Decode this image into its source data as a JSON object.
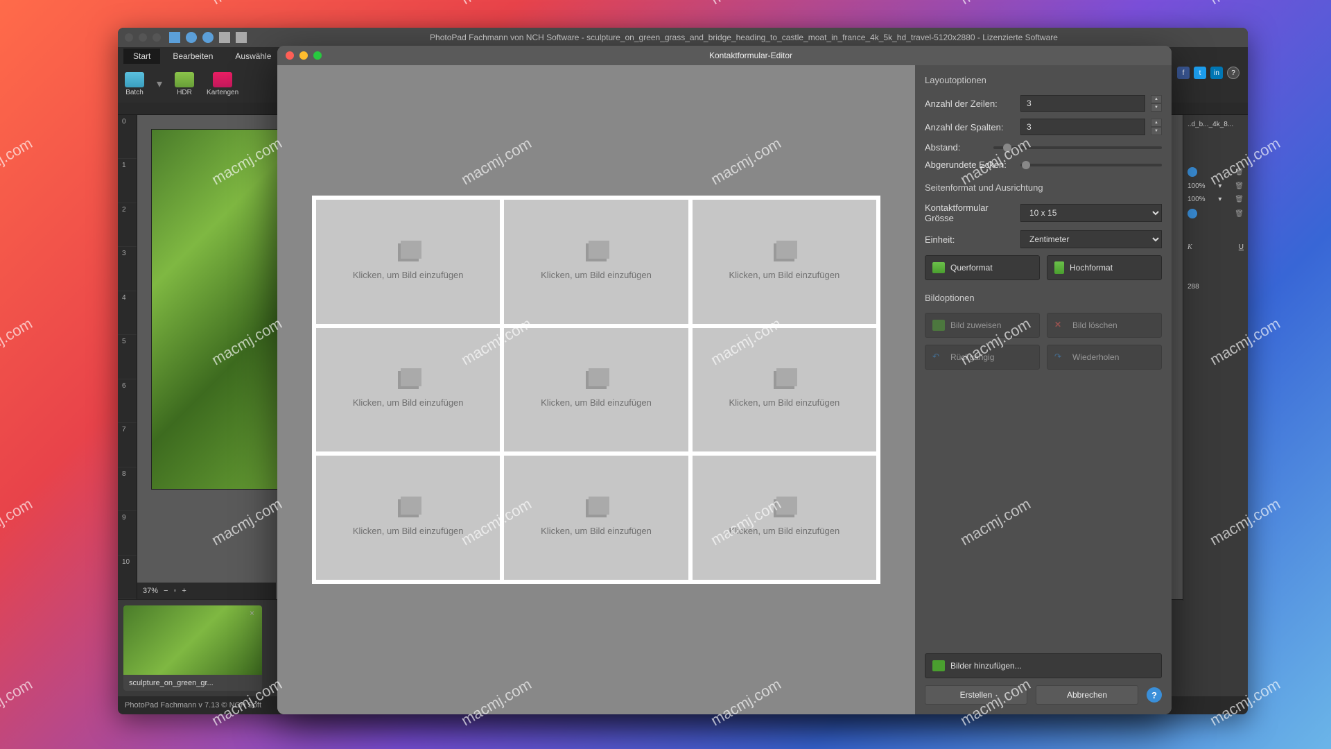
{
  "main_window": {
    "title": "PhotoPad Fachmann von NCH Software - sculpture_on_green_grass_and_bridge_heading_to_castle_moat_in_france_4k_5k_hd_travel-5120x2880 - Lizenzierte Software",
    "menu": [
      "Start",
      "Bearbeiten",
      "Auswähle"
    ],
    "tools": {
      "batch": "Batch",
      "hdr": "HDR",
      "card": "Kartengen"
    },
    "ruler_v": [
      "0",
      "1",
      "2",
      "3",
      "4",
      "5",
      "6",
      "7",
      "8",
      "9",
      "10"
    ],
    "zoom": "37%",
    "thumb_label": "sculpture_on_green_gr...",
    "statusbar": "PhotoPad Fachmann v 7.13 © NCH Soft",
    "right_filename": "..d_b..._4k_8...",
    "right_percent": "100%",
    "right_dim": "288"
  },
  "modal": {
    "title": "Kontaktformular-Editor",
    "cell_text": "Klicken, um Bild einzufügen",
    "sections": {
      "layout": "Layoutoptionen",
      "page": "Seitenformat und Ausrichtung",
      "image": "Bildoptionen"
    },
    "labels": {
      "rows": "Anzahl der Zeilen:",
      "cols": "Anzahl der Spalten:",
      "spacing": "Abstand:",
      "corners": "Abgerundete Ecken:",
      "size": "Kontaktformular Grösse",
      "unit": "Einheit:"
    },
    "values": {
      "rows": "3",
      "cols": "3",
      "size": "10 x 15",
      "unit": "Zentimeter"
    },
    "buttons": {
      "landscape": "Querformat",
      "portrait": "Hochformat",
      "assign": "Bild zuweisen",
      "remove": "Bild löschen",
      "undo": "Rückgängig",
      "redo": "Wiederholen",
      "add_images": "Bilder hinzufügen...",
      "create": "Erstellen",
      "cancel": "Abbrechen"
    }
  },
  "watermark": "macmj.com"
}
